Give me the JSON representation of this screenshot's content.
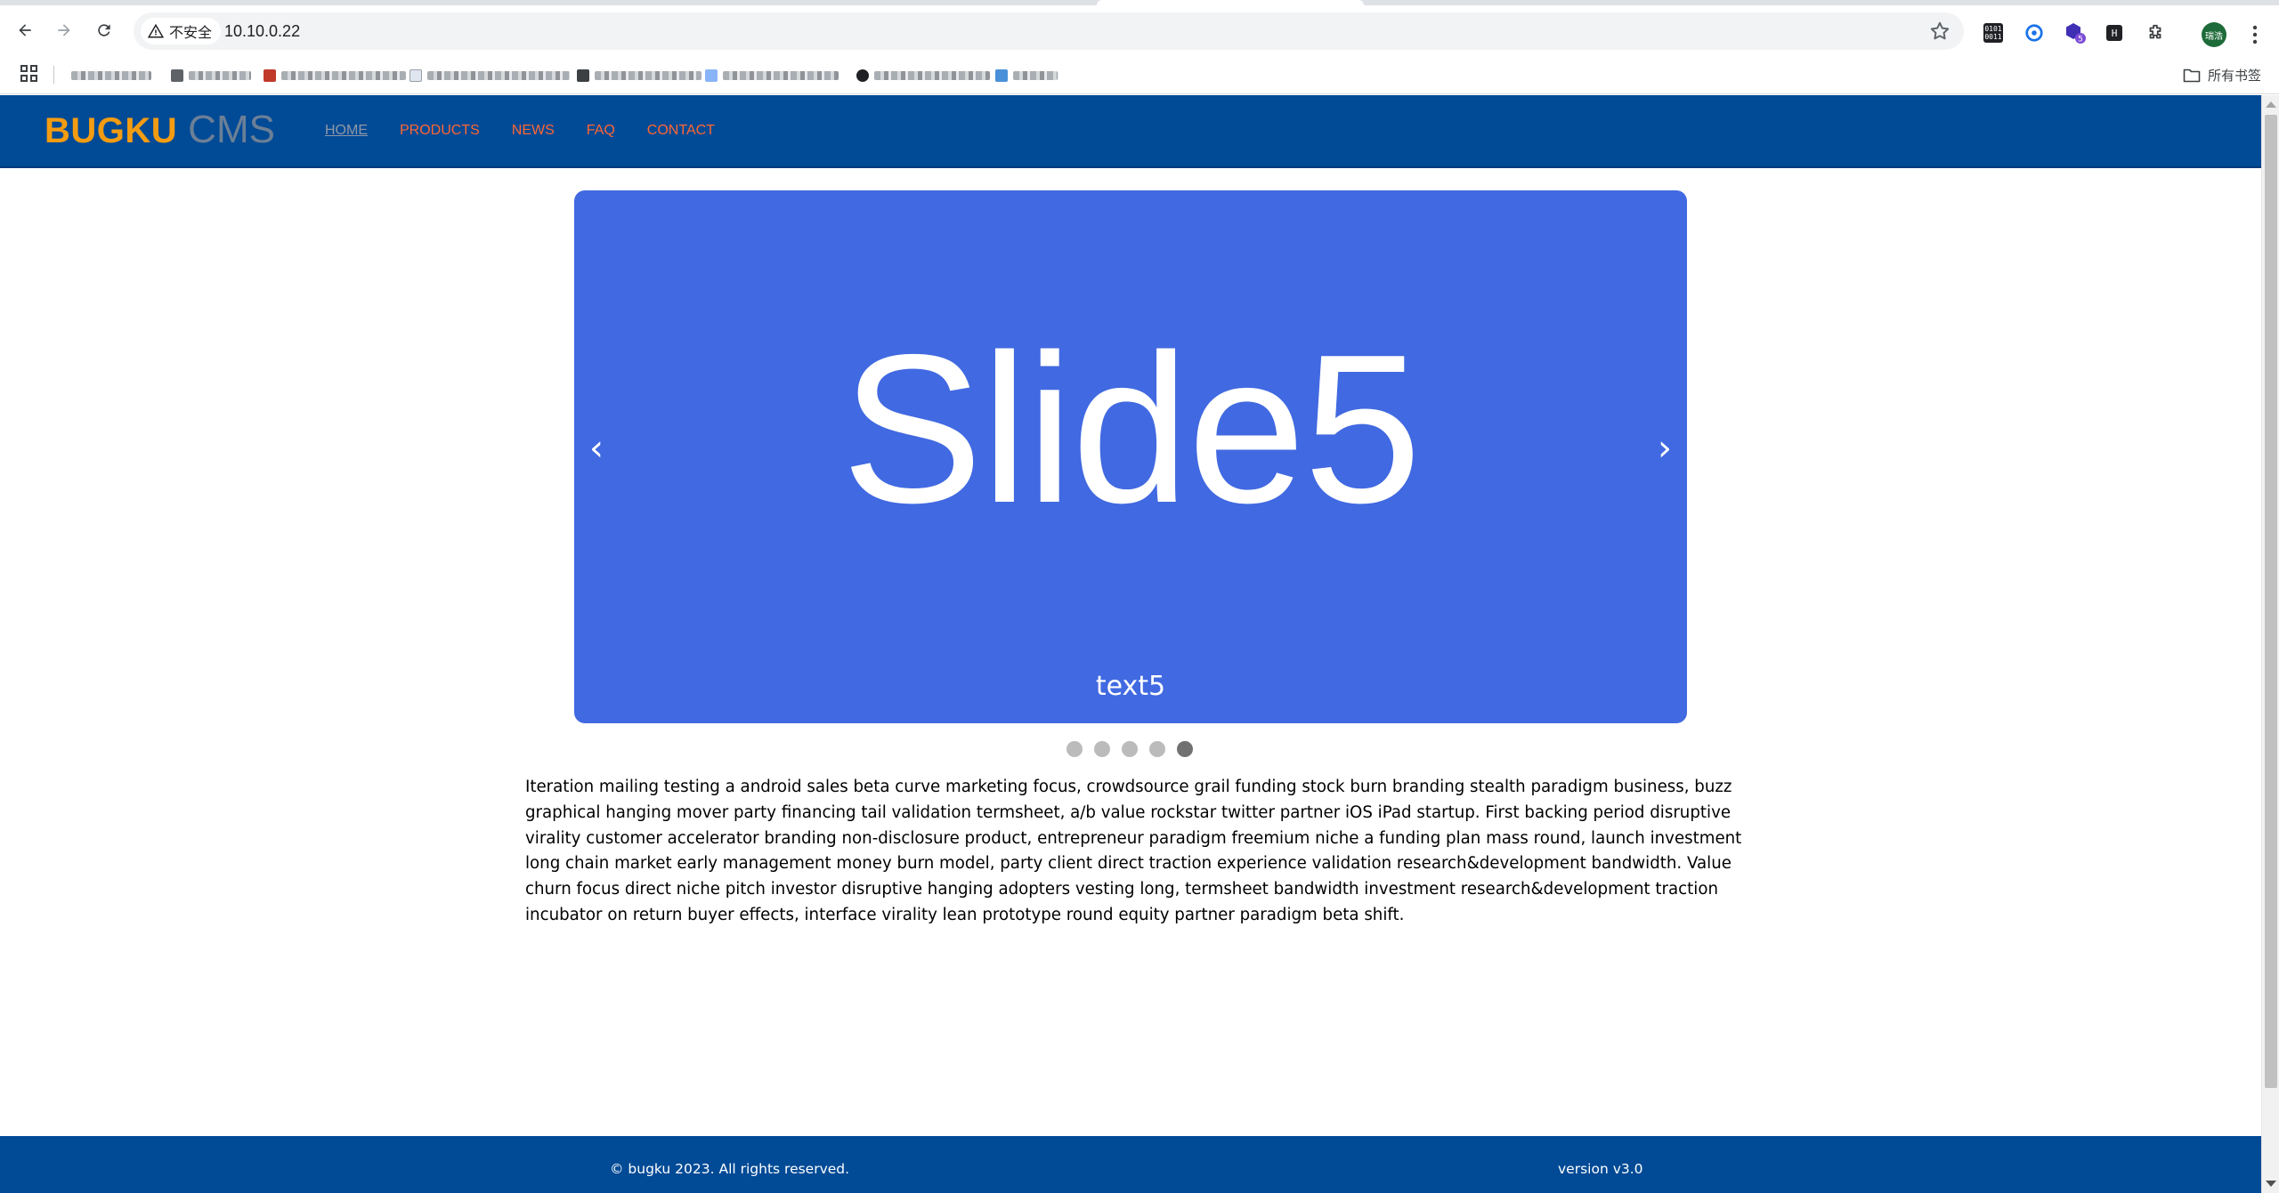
{
  "browser": {
    "security_label": "不安全",
    "url": "10.10.0.22",
    "all_bookmarks_label": "所有书签",
    "profile_initials": "瑞浩",
    "extension_box_label": "0101 0011",
    "extension_badge": "5",
    "extension_small_label": "H"
  },
  "site": {
    "logo_bold": "BUGKU",
    "logo_light": "CMS",
    "nav": [
      {
        "label": "HOME"
      },
      {
        "label": "PRODUCTS"
      },
      {
        "label": "NEWS"
      },
      {
        "label": "FAQ"
      },
      {
        "label": "CONTACT"
      }
    ],
    "colors": {
      "header_bg": "#004a96",
      "logo_accent": "#f39c12",
      "nav_link": "#ff6633",
      "slide_bg": "#4169e1"
    }
  },
  "carousel": {
    "title": "Slide5",
    "caption": "text5",
    "prev_symbol": "‹",
    "next_symbol": "›",
    "slide_count": 5,
    "active_index": 4
  },
  "content": {
    "paragraph": "Iteration mailing testing a android sales beta curve marketing focus, crowdsource grail funding stock burn branding stealth paradigm business, buzz graphical hanging mover party financing tail validation termsheet, a/b value rockstar twitter partner iOS iPad startup. First backing period disruptive virality customer accelerator branding non-disclosure product, entrepreneur paradigm freemium niche a funding plan mass round, launch investment long chain market early management money burn model, party client direct traction experience validation research&development bandwidth. Value churn focus direct niche pitch investor disruptive hanging adopters vesting long, termsheet bandwidth investment research&development traction incubator on return buyer effects, interface virality lean prototype round equity partner paradigm beta shift."
  },
  "footer": {
    "copyright": "© bugku 2023. All rights reserved.",
    "version": "version v3.0"
  }
}
